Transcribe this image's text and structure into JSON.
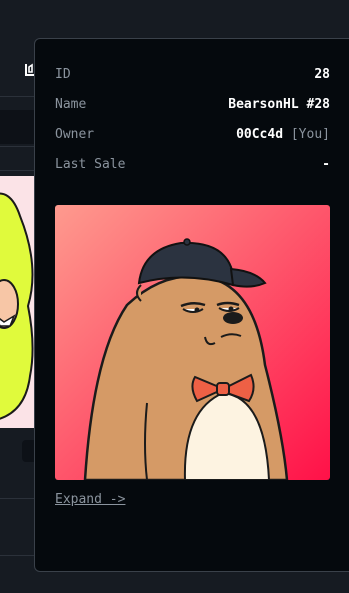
{
  "details": {
    "id_label": "ID",
    "id_value": "28",
    "name_label": "Name",
    "name_value": "BearsonHL #28",
    "owner_label": "Owner",
    "owner_value": "00Cc4d",
    "owner_tag": "[You]",
    "last_sale_label": "Last Sale",
    "last_sale_value": "-"
  },
  "image": {
    "subject": "bear-in-cap-and-bowtie",
    "gradient_colors": [
      "#fe9a8e",
      "#ff1148"
    ]
  },
  "expand_label": "Expand ->",
  "colors": {
    "popover_bg": "#05090d",
    "label": "#8b949e",
    "value": "#ffffff"
  }
}
